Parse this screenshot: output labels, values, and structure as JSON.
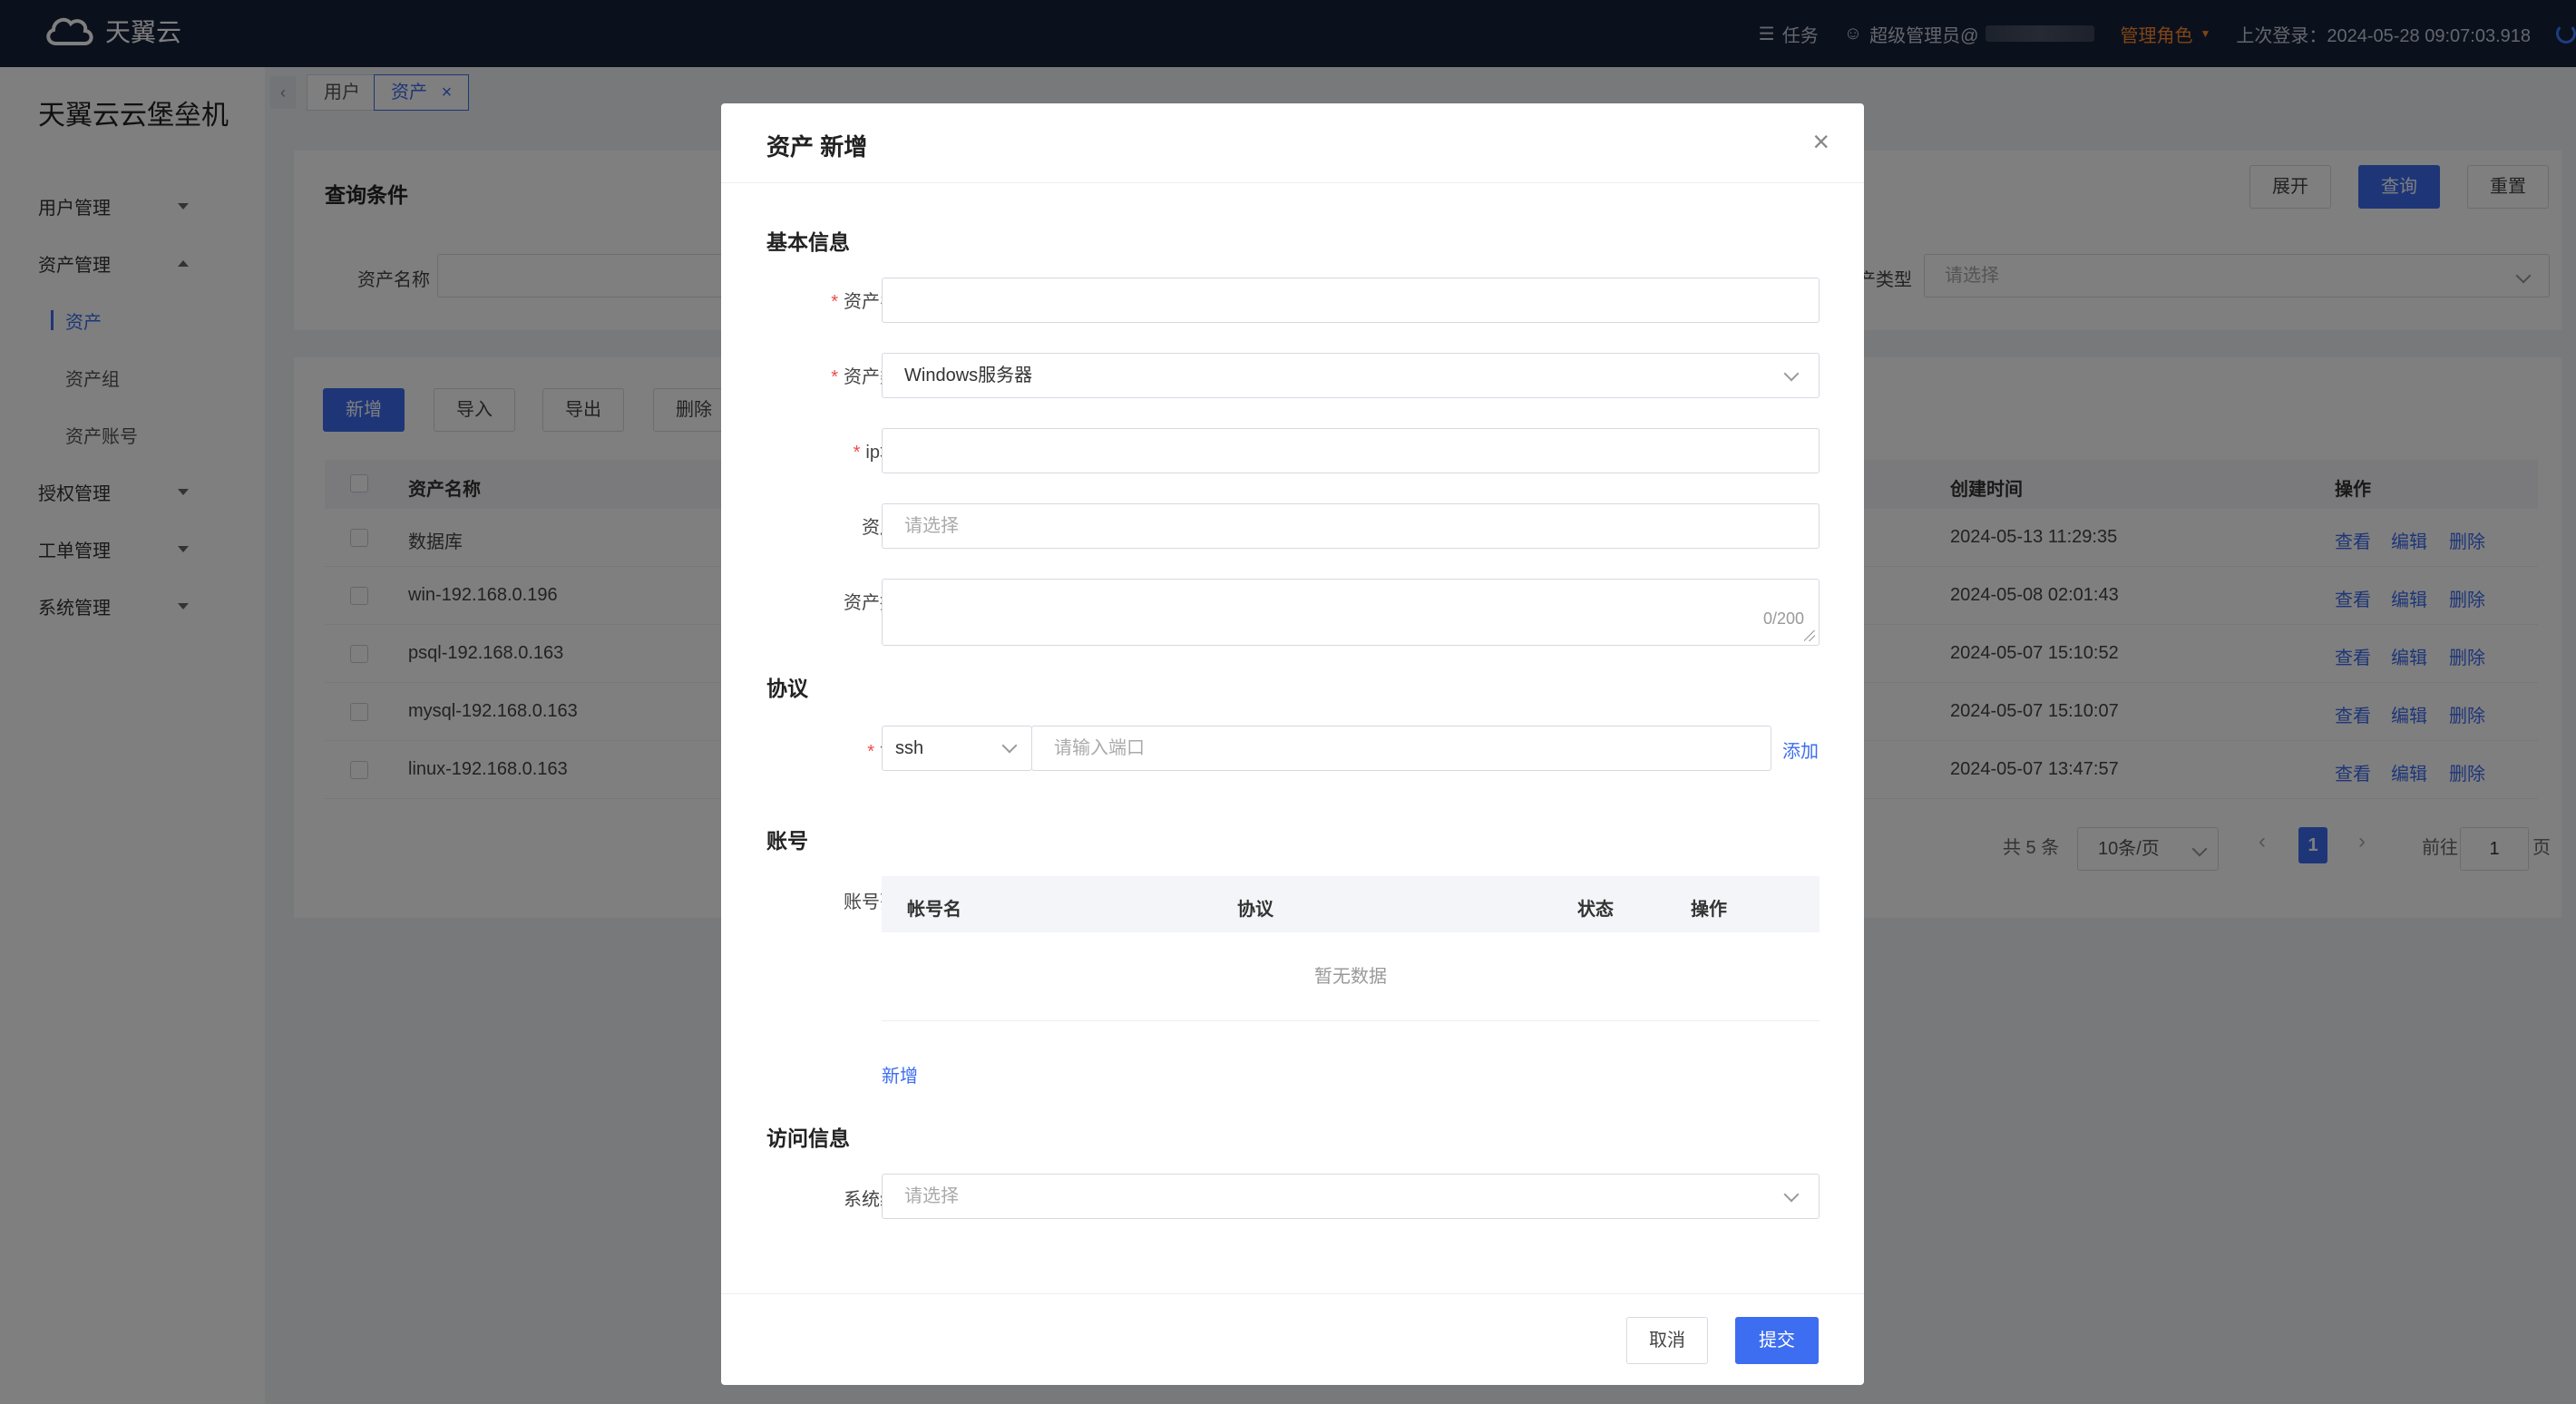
{
  "topbar": {
    "logo_text": "天翼云",
    "tasks_label": "任务",
    "user_label": "超级管理员@",
    "role_label": "管理角色",
    "last_login": "上次登录：2024-05-28 09:07:03.918"
  },
  "sidebar": {
    "brand": "天翼云云堡垒机",
    "items": [
      {
        "label": "用户管理"
      },
      {
        "label": "资产管理"
      },
      {
        "label": "资产"
      },
      {
        "label": "资产组"
      },
      {
        "label": "资产账号"
      },
      {
        "label": "授权管理"
      },
      {
        "label": "工单管理"
      },
      {
        "label": "系统管理"
      }
    ]
  },
  "tabs": [
    {
      "label": "用户"
    },
    {
      "label": "资产"
    }
  ],
  "query": {
    "title": "查询条件",
    "expand": "展开",
    "search": "查询",
    "reset": "重置",
    "asset_name_label": "资产名称",
    "asset_type_label": "产类型",
    "asset_type_placeholder": "请选择"
  },
  "toolbar": {
    "add": "新增",
    "import": "导入",
    "export": "导出",
    "delete": "删除"
  },
  "table": {
    "headers": {
      "name": "资产名称",
      "created": "创建时间",
      "ops": "操作"
    },
    "rows": [
      {
        "name": "数据库",
        "created": "2024-05-13 11:29:35"
      },
      {
        "name": "win-192.168.0.196",
        "created": "2024-05-08 02:01:43"
      },
      {
        "name": "psql-192.168.0.163",
        "created": "2024-05-07 15:10:52"
      },
      {
        "name": "mysql-192.168.0.163",
        "created": "2024-05-07 15:10:07"
      },
      {
        "name": "linux-192.168.0.163",
        "created": "2024-05-07 13:47:57"
      }
    ],
    "action_view": "查看",
    "action_edit": "编辑",
    "action_delete": "删除"
  },
  "pagination": {
    "total": "共 5 条",
    "page_size": "10条/页",
    "current": "1",
    "goto_label": "前往",
    "goto_value": "1",
    "page_suffix": "页"
  },
  "modal": {
    "title": "资产 新增",
    "basic_section": "基本信息",
    "asset_name_label": "资产名称",
    "asset_type_label": "资产类型",
    "asset_type_value": "Windows服务器",
    "ip_label": "ip地址",
    "group_label": "资产组",
    "group_placeholder": "请选择",
    "desc_label": "资产描述",
    "desc_counter": "0/200",
    "protocol_section": "协议",
    "protocol_label": "协议",
    "protocol_value": "ssh",
    "port_placeholder": "请输入端口",
    "add_protocol": "添加",
    "account_section": "账号",
    "account_list_label": "账号列表",
    "account_headers": {
      "name": "帐号名",
      "protocol": "协议",
      "status": "状态",
      "ops": "操作"
    },
    "empty_text": "暂无数据",
    "add_account": "新增",
    "access_section": "访问信息",
    "system_code_label": "系统编码",
    "system_code_placeholder": "请选择",
    "cancel": "取消",
    "submit": "提交"
  }
}
